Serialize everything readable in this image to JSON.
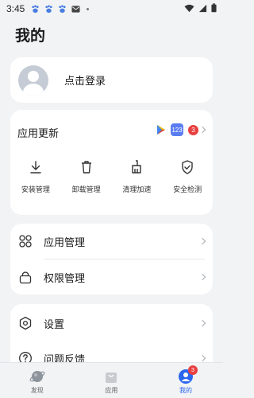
{
  "status_bar": {
    "time": "3:45",
    "icons": [
      "notification-paw-icon",
      "notification-paw-icon",
      "notification-paw-icon",
      "mail-icon",
      "dot-icon",
      "wifi-icon",
      "signal-icon",
      "battery-icon"
    ]
  },
  "page": {
    "title": "我的"
  },
  "login": {
    "label": "点击登录"
  },
  "updates": {
    "title": "应用更新",
    "badge_count": "3",
    "app_icons": [
      "google-play-icon",
      "app-123-icon"
    ],
    "mini_app_text": "123"
  },
  "tools": [
    {
      "label": "安装管理",
      "icon": "download-icon"
    },
    {
      "label": "卸载管理",
      "icon": "trash-icon"
    },
    {
      "label": "清理加速",
      "icon": "broom-icon"
    },
    {
      "label": "安全检测",
      "icon": "shield-check-icon"
    }
  ],
  "manage": [
    {
      "label": "应用管理",
      "icon": "apps-grid-icon"
    },
    {
      "label": "权限管理",
      "icon": "lock-icon"
    }
  ],
  "settings": [
    {
      "label": "设置",
      "icon": "gear-icon"
    },
    {
      "label": "问题反馈",
      "icon": "help-circle-icon"
    }
  ],
  "bottom_nav": [
    {
      "label": "发现",
      "icon": "planet-icon"
    },
    {
      "label": "应用",
      "icon": "bag-icon"
    },
    {
      "label": "我的",
      "icon": "profile-icon",
      "badge": "3",
      "active": true
    }
  ],
  "colors": {
    "accent": "#2a66ee",
    "badge": "#e84040",
    "background": "#f1f3f5"
  }
}
